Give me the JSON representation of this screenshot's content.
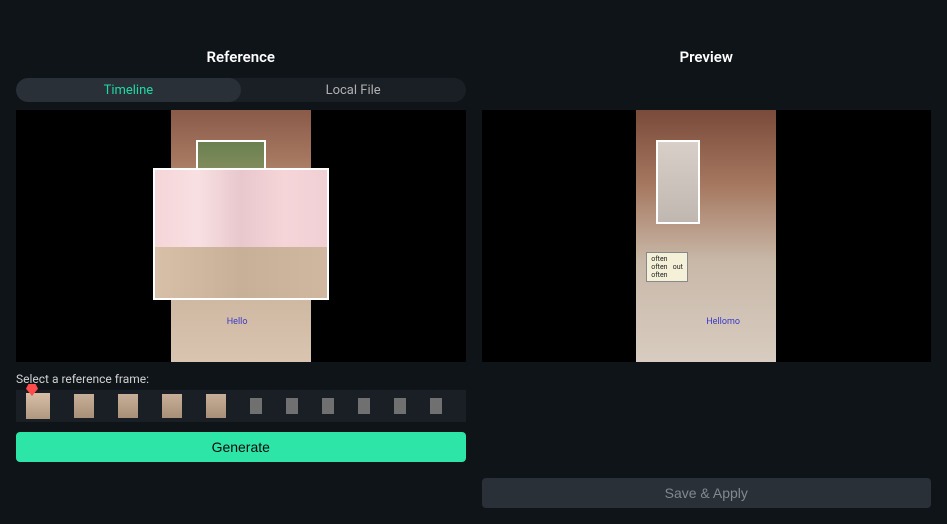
{
  "reference": {
    "title": "Reference",
    "tabs": {
      "timeline": "Timeline",
      "local_file": "Local File"
    },
    "frame_label": "Select a reference frame:",
    "overlay_text_1": "Hello",
    "generate_label": "Generate"
  },
  "preview": {
    "title": "Preview",
    "label_lines": "often\noften   out\noften",
    "overlay_text_1": "Hellomo",
    "save_label": "Save & Apply"
  }
}
